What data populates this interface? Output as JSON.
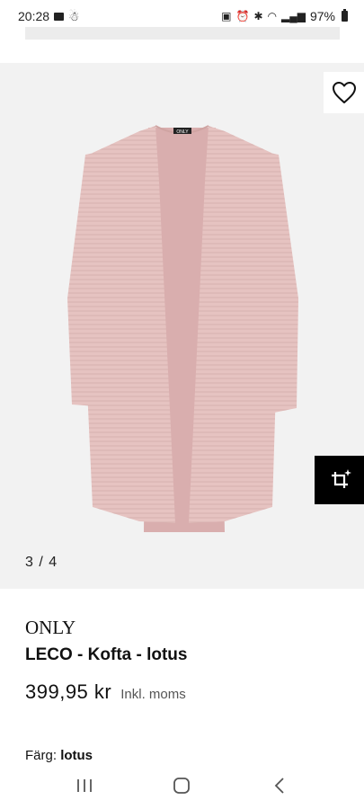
{
  "status_bar": {
    "time": "20:28",
    "battery_percent": "97%",
    "icons": [
      "folder-icon",
      "android-icon",
      "battery-saver-icon",
      "alarm-icon",
      "bluetooth-icon",
      "wifi-icon",
      "signal-icon",
      "battery-icon"
    ]
  },
  "gallery": {
    "counter": "3 / 4",
    "current_image": 3,
    "total_images": 4,
    "product_color_hex": "#e6c3c1"
  },
  "product": {
    "brand": "ONLY",
    "name": "LECO - Kofta - lotus",
    "price": "399,95 kr",
    "vat_note": "Inkl. moms",
    "color_label": "Färg:",
    "color_value": "lotus"
  },
  "label_text": "ONLY",
  "colors": {
    "gallery_bg": "#f2f2f2",
    "similar_button_bg": "#000000",
    "text": "#111111"
  }
}
